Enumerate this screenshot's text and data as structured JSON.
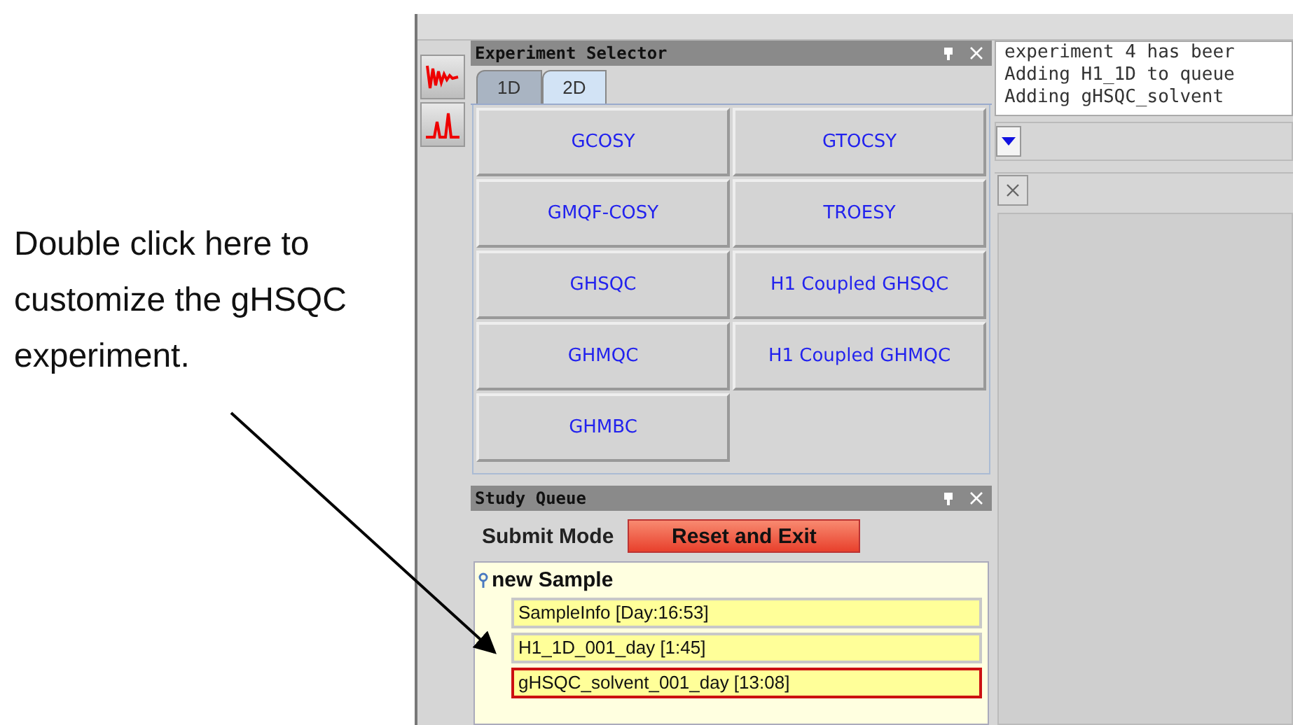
{
  "annotation": {
    "text": "Double click here to customize the gHSQC experiment."
  },
  "experiment_selector": {
    "title": "Experiment Selector",
    "tabs": [
      {
        "label": "1D",
        "selected": false
      },
      {
        "label": "2D",
        "selected": true
      }
    ],
    "experiments": [
      "GCOSY",
      "GTOCSY",
      "GMQF-COSY",
      "TROESY",
      "GHSQC",
      "H1 Coupled GHSQC",
      "GHMQC",
      "H1 Coupled GHMQC",
      "GHMBC"
    ]
  },
  "study_queue": {
    "title": "Study Queue",
    "mode_label": "Submit Mode",
    "button": "Reset and Exit",
    "sample": "new Sample",
    "items": [
      {
        "label": "SampleInfo [Day:16:53]",
        "selected": false
      },
      {
        "label": "H1_1D_001_day [1:45]",
        "selected": false
      },
      {
        "label": "gHSQC_solvent_001_day [13:08]",
        "selected": true
      }
    ]
  },
  "log": [
    "experiment 4 has beer",
    "Adding H1_1D to queue",
    "Adding gHSQC_solvent"
  ]
}
